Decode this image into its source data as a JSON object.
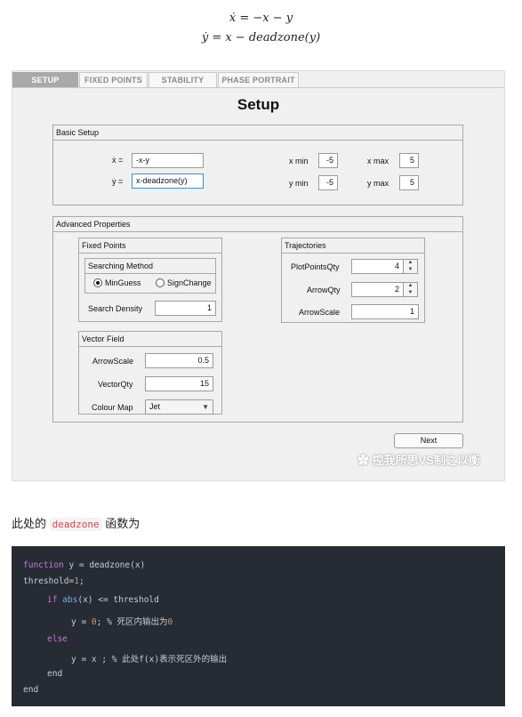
{
  "equations": {
    "line1": "ẋ = −x − y",
    "line2": "ẏ = x − deadzone(y)"
  },
  "tabs": [
    "SETUP",
    "FIXED POINTS",
    "STABILITY",
    "PHASE PORTRAIT"
  ],
  "active_tab": "SETUP",
  "page_title": "Setup",
  "basic_setup": {
    "title": "Basic Setup",
    "xdot_label": "ẋ =",
    "xdot_value": "-x-y",
    "ydot_label": "ẏ =",
    "ydot_value": "x-deadzone(y)",
    "xmin_label": "x min",
    "xmin_value": "-5",
    "xmax_label": "x max",
    "xmax_value": "5",
    "ymin_label": "y min",
    "ymin_value": "-5",
    "ymax_label": "y max",
    "ymax_value": "5"
  },
  "advanced": {
    "title": "Advanced Properties",
    "fixed_points": {
      "title": "Fixed Points",
      "searching_method": {
        "title": "Searching Method",
        "options": [
          "MinGuess",
          "SignChange"
        ],
        "selected": "MinGuess"
      },
      "search_density_label": "Search Density",
      "search_density_value": "1"
    },
    "trajectories": {
      "title": "Trajectories",
      "plot_points_label": "PlotPointsQty",
      "plot_points_value": "4",
      "arrow_qty_label": "ArrowQty",
      "arrow_qty_value": "2",
      "arrow_scale_label": "ArrowScale",
      "arrow_scale_value": "1"
    },
    "vector_field": {
      "title": "Vector Field",
      "arrow_scale_label": "ArrowScale",
      "arrow_scale_value": "0.5",
      "vector_qty_label": "VectorQty",
      "vector_qty_value": "15",
      "colour_map_label": "Colour Map",
      "colour_map_value": "Jet"
    }
  },
  "next_button": "Next",
  "watermark": "控我所思VS制之以衡",
  "paragraph": {
    "before": "此处的 ",
    "code": "deadzone",
    "after": " 函数为"
  },
  "code_lines": [
    "function y = deadzone(x)",
    "threshold=1;",
    "if abs(x) <= threshold",
    "y = 0; % 死区内输出为0",
    "else",
    "y = x ; % 此处f(x)表示死区外的输出",
    "end",
    "end"
  ],
  "colors": {
    "code_bg": "#272b34",
    "keyword": "#c678dd",
    "builtin": "#61afef",
    "number": "#d19a66",
    "inline_code": "#d14a4a",
    "active_tab_bg": "#a9a9a9"
  }
}
